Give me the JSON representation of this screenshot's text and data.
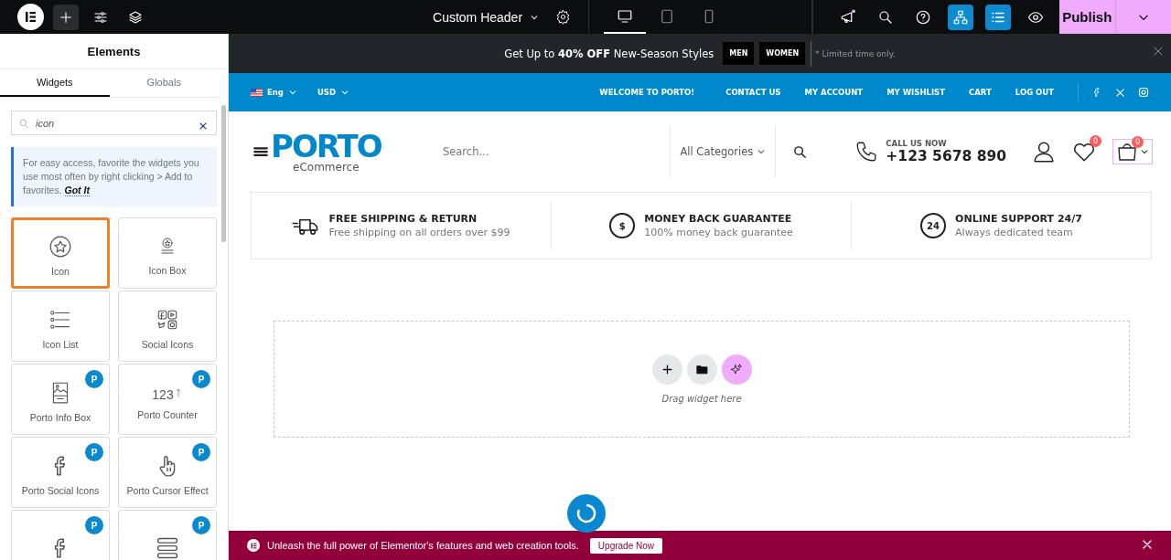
{
  "topbar": {
    "document_title": "Custom Header",
    "devices": [
      {
        "kind": "desktop",
        "selected": true
      },
      {
        "kind": "tablet",
        "selected": false
      },
      {
        "kind": "mobile",
        "selected": false
      }
    ],
    "publish": "Publish"
  },
  "panel": {
    "title": "Elements",
    "tabs": [
      {
        "label": "Widgets",
        "selected": true
      },
      {
        "label": "Globals",
        "selected": false
      }
    ],
    "search": {
      "value": "icon"
    },
    "tip": {
      "text": "For easy access, favorite the widgets you use most often by right clicking > Add to favorites.",
      "link": "Got It"
    },
    "widgets": [
      {
        "label": "Icon",
        "kind": "star",
        "selected": true
      },
      {
        "label": "Icon Box",
        "kind": "iconbox",
        "selected": false
      },
      {
        "label": "Icon List",
        "kind": "list",
        "selected": false
      },
      {
        "label": "Social Icons",
        "kind": "social",
        "selected": false
      },
      {
        "label": "Porto Info Box",
        "kind": "infobox",
        "badge": "P",
        "selected": false
      },
      {
        "label": "Porto Counter",
        "kind": "counter",
        "glyph": "123",
        "badge": "P",
        "selected": false
      },
      {
        "label": "Porto Social Icons",
        "kind": "facebook",
        "badge": "P",
        "selected": false
      },
      {
        "label": "Porto Cursor Effect",
        "kind": "cursor",
        "badge": "P",
        "selected": false
      },
      {
        "kind": "facebook",
        "badge": "P",
        "selected": false
      },
      {
        "kind": "menu",
        "badge": "P",
        "selected": false
      }
    ]
  },
  "announcement": {
    "text": "Get Up to **40% OFF** New-Season Styles",
    "buttons": [
      "MEN",
      "WOMEN"
    ],
    "note": "* Limited time only."
  },
  "topnav": {
    "language": "Eng",
    "currency": "USD",
    "links": [
      "WELCOME TO PORTO!",
      "CONTACT US",
      "MY ACCOUNT",
      "MY WISHLIST",
      "CART",
      "LOG OUT"
    ]
  },
  "header": {
    "logo": "PORTO",
    "tagline": "eCommerce",
    "search_placeholder": "Search...",
    "category": "All Categories",
    "call_label": "CALL US NOW",
    "phone": "+123 5678 890",
    "wishlist_count": "0",
    "cart_count": "0"
  },
  "features": [
    {
      "kind": "truck",
      "title": "FREE SHIPPING & RETURN",
      "subtitle": "Free shipping on all orders over $99"
    },
    {
      "kind": "dollar",
      "glyph": "$",
      "title": "MONEY BACK GUARANTEE",
      "subtitle": "100% money back guarantee"
    },
    {
      "kind": "support",
      "glyph": "24",
      "title": "ONLINE SUPPORT 24/7",
      "subtitle": "Always dedicated team"
    }
  ],
  "drop_zone": {
    "hint": "Drag widget here"
  },
  "promo": {
    "text": "Unleash the full power of Elementor's features and web creation tools.",
    "button": "Upgrade Now"
  }
}
